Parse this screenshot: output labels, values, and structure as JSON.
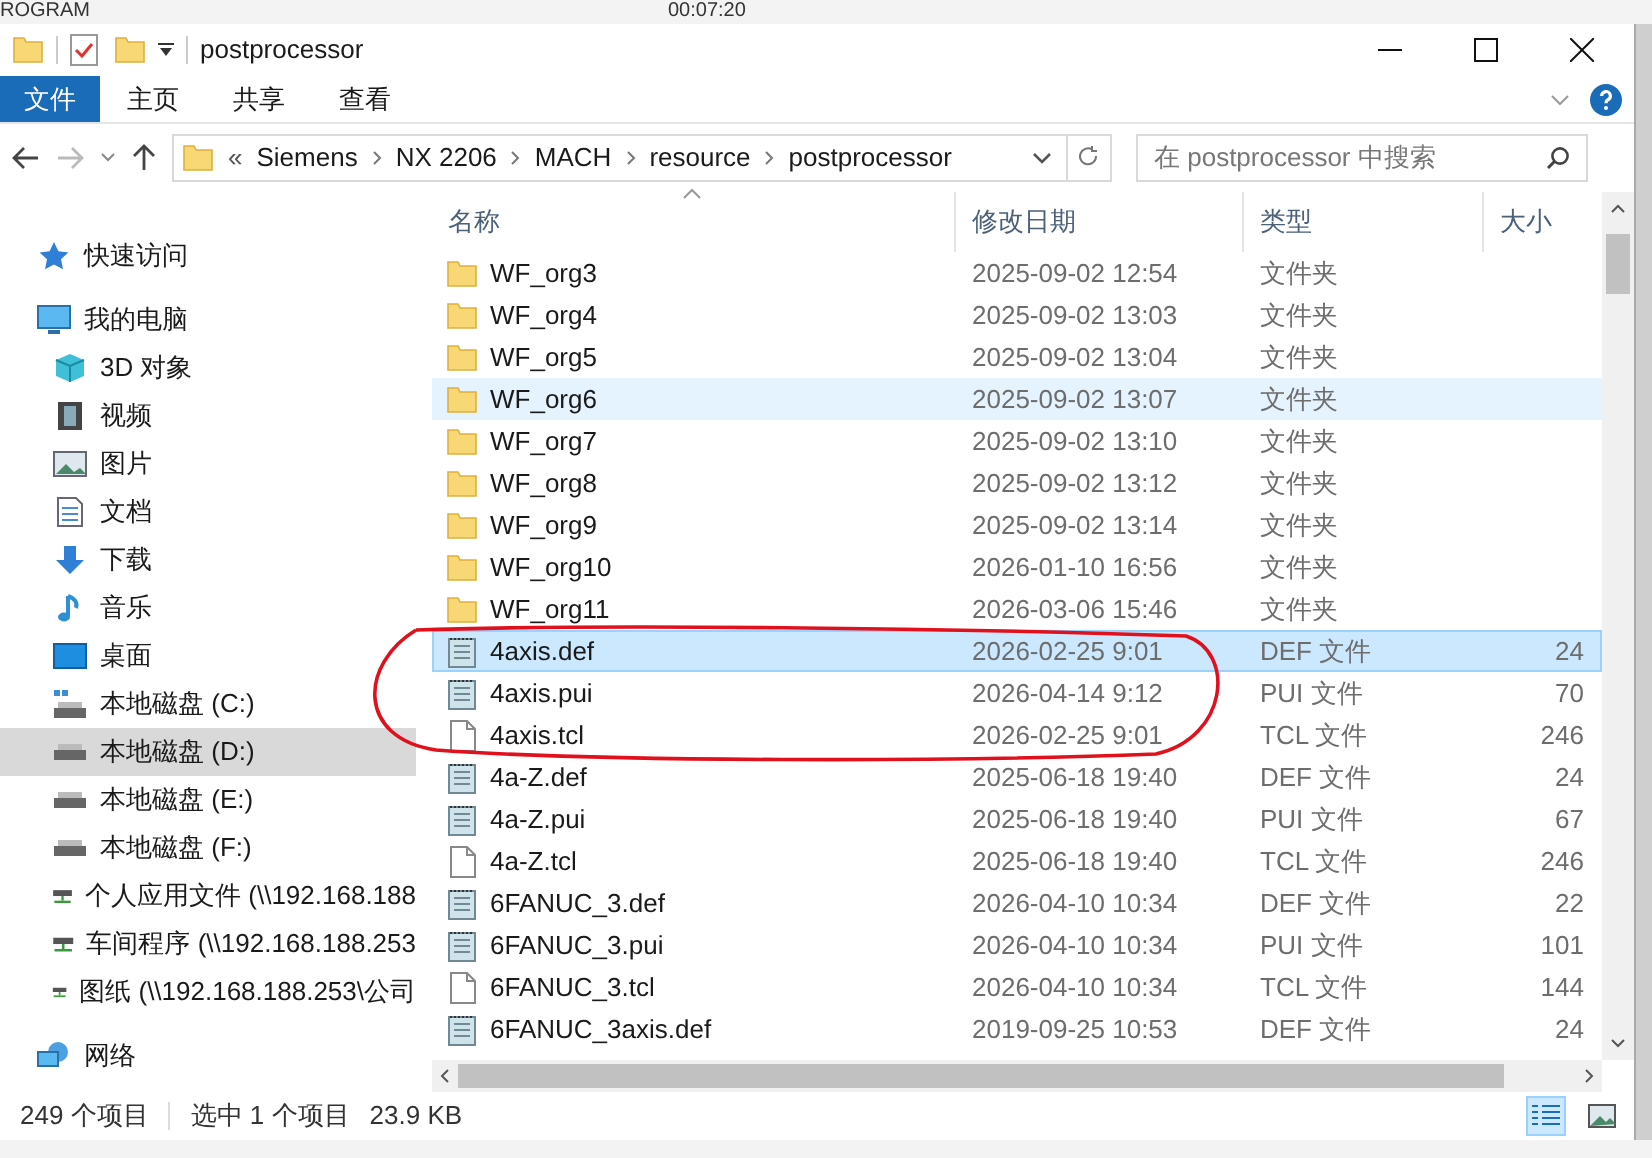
{
  "background_app": {
    "texts": [
      "ROGRAM",
      "00:07:20"
    ]
  },
  "window": {
    "title": "postprocessor"
  },
  "ribbon_tabs": [
    {
      "label": "文件",
      "selected": true
    },
    {
      "label": "主页",
      "selected": false
    },
    {
      "label": "共享",
      "selected": false
    },
    {
      "label": "查看",
      "selected": false
    }
  ],
  "address_bar": {
    "overflow": "«",
    "crumbs": [
      "Siemens",
      "NX 2206",
      "MACH",
      "resource",
      "postprocessor"
    ]
  },
  "search": {
    "placeholder": "在 postprocessor 中搜索"
  },
  "sidebar": {
    "items": [
      {
        "label": "快速访问",
        "kind": "star",
        "selected": false
      },
      {
        "label": "我的电脑",
        "kind": "pc",
        "selected": false,
        "children": [
          {
            "label": "3D 对象",
            "kind": "cube",
            "selected": false
          },
          {
            "label": "视频",
            "kind": "video",
            "selected": false
          },
          {
            "label": "图片",
            "kind": "picture",
            "selected": false
          },
          {
            "label": "文档",
            "kind": "document",
            "selected": false
          },
          {
            "label": "下载",
            "kind": "download",
            "selected": false
          },
          {
            "label": "音乐",
            "kind": "music",
            "selected": false
          },
          {
            "label": "桌面",
            "kind": "desktop",
            "selected": false
          },
          {
            "label": "本地磁盘 (C:)",
            "kind": "system-drive",
            "selected": false
          },
          {
            "label": "本地磁盘 (D:)",
            "kind": "drive",
            "selected": true
          },
          {
            "label": "本地磁盘 (E:)",
            "kind": "drive",
            "selected": false
          },
          {
            "label": "本地磁盘 (F:)",
            "kind": "drive",
            "selected": false
          },
          {
            "label": "个人应用文件 (\\\\192.168.188",
            "kind": "network-drive",
            "selected": false
          },
          {
            "label": "车间程序 (\\\\192.168.188.253",
            "kind": "network-drive",
            "selected": false
          },
          {
            "label": "图纸 (\\\\192.168.188.253\\公司",
            "kind": "network-drive",
            "selected": false
          }
        ]
      },
      {
        "label": "网络",
        "kind": "network",
        "selected": false
      }
    ]
  },
  "table": {
    "columns": [
      "名称",
      "修改日期",
      "类型",
      "大小"
    ],
    "rows": [
      {
        "name": "WF_org3",
        "date": "2025-09-02 12:54",
        "type": "文件夹",
        "size": "",
        "kind": "folder",
        "selected": false,
        "hovered": false
      },
      {
        "name": "WF_org4",
        "date": "2025-09-02 13:03",
        "type": "文件夹",
        "size": "",
        "kind": "folder",
        "selected": false,
        "hovered": false
      },
      {
        "name": "WF_org5",
        "date": "2025-09-02 13:04",
        "type": "文件夹",
        "size": "",
        "kind": "folder",
        "selected": false,
        "hovered": false
      },
      {
        "name": "WF_org6",
        "date": "2025-09-02 13:07",
        "type": "文件夹",
        "size": "",
        "kind": "folder",
        "selected": false,
        "hovered": true
      },
      {
        "name": "WF_org7",
        "date": "2025-09-02 13:10",
        "type": "文件夹",
        "size": "",
        "kind": "folder",
        "selected": false,
        "hovered": false
      },
      {
        "name": "WF_org8",
        "date": "2025-09-02 13:12",
        "type": "文件夹",
        "size": "",
        "kind": "folder",
        "selected": false,
        "hovered": false
      },
      {
        "name": "WF_org9",
        "date": "2025-09-02 13:14",
        "type": "文件夹",
        "size": "",
        "kind": "folder",
        "selected": false,
        "hovered": false
      },
      {
        "name": "WF_org10",
        "date": "2026-01-10 16:56",
        "type": "文件夹",
        "size": "",
        "kind": "folder",
        "selected": false,
        "hovered": false
      },
      {
        "name": "WF_org11",
        "date": "2026-03-06 15:46",
        "type": "文件夹",
        "size": "",
        "kind": "folder",
        "selected": false,
        "hovered": false
      },
      {
        "name": "4axis.def",
        "date": "2026-02-25 9:01",
        "type": "DEF 文件",
        "size": "24",
        "kind": "text",
        "selected": true,
        "hovered": false
      },
      {
        "name": "4axis.pui",
        "date": "2026-04-14 9:12",
        "type": "PUI 文件",
        "size": "70",
        "kind": "text",
        "selected": false,
        "hovered": false
      },
      {
        "name": "4axis.tcl",
        "date": "2026-02-25 9:01",
        "type": "TCL 文件",
        "size": "246",
        "kind": "blank",
        "selected": false,
        "hovered": false
      },
      {
        "name": "4a-Z.def",
        "date": "2025-06-18 19:40",
        "type": "DEF 文件",
        "size": "24",
        "kind": "text",
        "selected": false,
        "hovered": false
      },
      {
        "name": "4a-Z.pui",
        "date": "2025-06-18 19:40",
        "type": "PUI 文件",
        "size": "67",
        "kind": "text",
        "selected": false,
        "hovered": false
      },
      {
        "name": "4a-Z.tcl",
        "date": "2025-06-18 19:40",
        "type": "TCL 文件",
        "size": "246",
        "kind": "blank",
        "selected": false,
        "hovered": false
      },
      {
        "name": "6FANUC_3.def",
        "date": "2026-04-10 10:34",
        "type": "DEF 文件",
        "size": "22",
        "kind": "text",
        "selected": false,
        "hovered": false
      },
      {
        "name": "6FANUC_3.pui",
        "date": "2026-04-10 10:34",
        "type": "PUI 文件",
        "size": "101",
        "kind": "text",
        "selected": false,
        "hovered": false
      },
      {
        "name": "6FANUC_3.tcl",
        "date": "2026-04-10 10:34",
        "type": "TCL 文件",
        "size": "144",
        "kind": "blank",
        "selected": false,
        "hovered": false
      },
      {
        "name": "6FANUC_3axis.def",
        "date": "2019-09-25 10:53",
        "type": "DEF 文件",
        "size": "24",
        "kind": "text",
        "selected": false,
        "hovered": false
      }
    ]
  },
  "annotation_circle": true,
  "status_bar": {
    "count": "249 个项目",
    "selection": "选中 1 个项目",
    "size": "23.9 KB",
    "view_buttons": [
      {
        "kind": "details",
        "selected": true
      },
      {
        "kind": "icons",
        "selected": false
      }
    ]
  }
}
